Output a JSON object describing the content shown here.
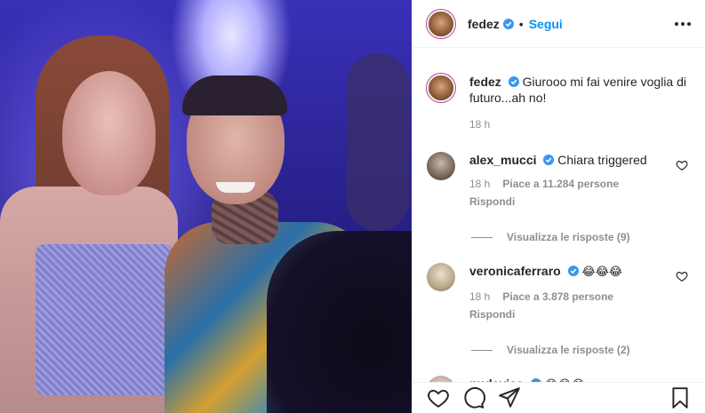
{
  "post": {
    "author": "fedez",
    "dot": "•",
    "follow_label": "Segui"
  },
  "caption": {
    "author": "fedez",
    "text": "Giurooo mi fai venire voglia di futuro...ah no!",
    "time": "18 h"
  },
  "comments": [
    {
      "user": "alex_mucci",
      "text": "Chiara triggered",
      "time": "18 h",
      "likes": "Piace a 11.284 persone",
      "reply_label": "Rispondi",
      "view_replies": "Visualizza le risposte (9)"
    },
    {
      "user": "veronicaferraro",
      "text": "😂😂😂",
      "time": "18 h",
      "likes": "Piace a 3.878 persone",
      "reply_label": "Rispondi",
      "view_replies": "Visualizza le risposte (2)"
    },
    {
      "user": "nudevice",
      "text": "😂😂😂"
    }
  ],
  "icons": {
    "verified": "verified-badge-icon",
    "more": "more-options-icon",
    "like": "heart-icon",
    "comment": "comment-icon",
    "share": "paper-plane-icon",
    "save": "bookmark-icon"
  },
  "colors": {
    "link": "#0095f6",
    "text": "#262626",
    "muted": "#8e8e8e",
    "verified": "#3897f0"
  }
}
